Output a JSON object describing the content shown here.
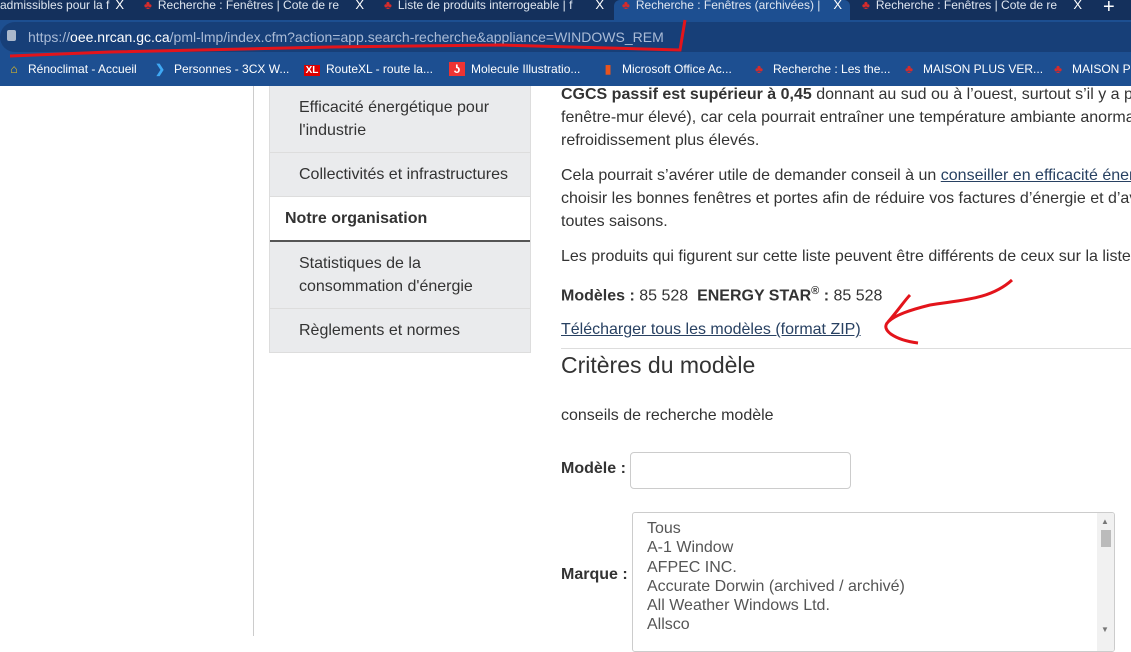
{
  "browser": {
    "tabs": [
      {
        "title": "admissibles pour la f"
      },
      {
        "title": "Recherche : Fenêtres | Cote de re"
      },
      {
        "title": "Liste de produits interrogeable | f"
      },
      {
        "title": "Recherche : Fenêtres (archivées) |",
        "active": true
      },
      {
        "title": "Recherche : Fenêtres | Cote de re"
      }
    ],
    "close_glyph": "X",
    "new_tab": "+",
    "url_prefix": "https://",
    "url_domain": "oee.nrcan.gc.ca",
    "url_path": "/pml-lmp/index.cfm?action=app.search-recherche&appliance=WINDOWS_REM",
    "bookmarks": [
      {
        "label": "Rénoclimat - Accueil",
        "icon": "house-icon"
      },
      {
        "label": "Personnes - 3CX W...",
        "icon": "chevron-icon"
      },
      {
        "label": "RouteXL - route la...",
        "icon": "xl-icon",
        "icon_text": "XL"
      },
      {
        "label": "Molecule Illustratio...",
        "icon": "molecule-icon"
      },
      {
        "label": "Microsoft Office Ac...",
        "icon": "office-icon"
      },
      {
        "label": "Recherche : Les the...",
        "icon": "maple-leaf-icon"
      },
      {
        "label": "MAISON PLUS VER...",
        "icon": "maple-leaf-icon"
      },
      {
        "label": "MAISON PLUS",
        "icon": "maple-leaf-icon"
      }
    ]
  },
  "sidebar": {
    "items": [
      {
        "label": "Efficacité énergétique pour l'industrie"
      },
      {
        "label": "Collectivités et infrastructures"
      },
      {
        "label": "Notre organisation",
        "heading": true
      },
      {
        "label": "Statistiques de la consommation d'énergie"
      },
      {
        "label": "Règlements et normes"
      }
    ]
  },
  "main": {
    "p1": {
      "bold": "CGCS passif est supérieur à 0,45",
      "line1_rest": " donnant au sud ou à l’ouest, surtout s’il y a p",
      "line2": "fenêtre-mur élevé), car cela pourrait entraîner une température ambiante anorma",
      "line3": "refroidissement plus élevés."
    },
    "p2": {
      "line1_start": "Cela pourrait s’avérer utile de demander conseil à un ",
      "link": "conseiller en efficacité éner",
      "line2": "choisir les bonnes fenêtres et portes afin de réduire vos factures d’énergie et d’av",
      "line3": "toutes saisons."
    },
    "p3": "Les produits qui figurent sur cette liste peuvent être différents de ceux sur la liste",
    "counts": {
      "models_label": "Modèles :",
      "models_value": "85 528",
      "es_label": "ENERGY STAR",
      "es_sup": "®",
      "es_colon": " :",
      "es_value": "85 528"
    },
    "download_link": "Télécharger tous les modèles (format ZIP)",
    "criteria_heading": "Critères du modèle",
    "tips": "conseils de recherche modèle",
    "model_label": "Modèle :",
    "model_value": "",
    "brand_label": "Marque :",
    "brand_options": [
      "Tous",
      "A-1 Window",
      "AFPEC INC.",
      "Accurate Dorwin (archived / archivé)",
      "All Weather Windows Ltd.",
      "Allsco"
    ]
  },
  "colors": {
    "annotation": "#e3141b",
    "link": "#284162",
    "chrome": "#1d4f91"
  }
}
